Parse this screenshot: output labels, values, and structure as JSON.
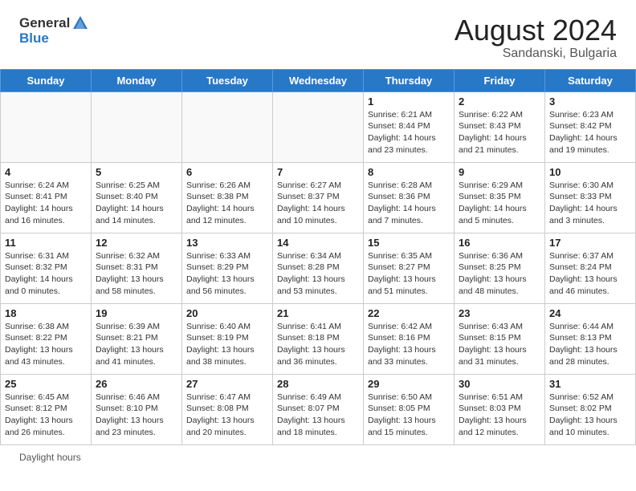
{
  "header": {
    "logo_general": "General",
    "logo_blue": "Blue",
    "month_year": "August 2024",
    "location": "Sandanski, Bulgaria"
  },
  "days_of_week": [
    "Sunday",
    "Monday",
    "Tuesday",
    "Wednesday",
    "Thursday",
    "Friday",
    "Saturday"
  ],
  "legend": {
    "daylight_label": "Daylight hours"
  },
  "weeks": [
    [
      {
        "day": "",
        "info": ""
      },
      {
        "day": "",
        "info": ""
      },
      {
        "day": "",
        "info": ""
      },
      {
        "day": "",
        "info": ""
      },
      {
        "day": "1",
        "info": "Sunrise: 6:21 AM\nSunset: 8:44 PM\nDaylight: 14 hours\nand 23 minutes."
      },
      {
        "day": "2",
        "info": "Sunrise: 6:22 AM\nSunset: 8:43 PM\nDaylight: 14 hours\nand 21 minutes."
      },
      {
        "day": "3",
        "info": "Sunrise: 6:23 AM\nSunset: 8:42 PM\nDaylight: 14 hours\nand 19 minutes."
      }
    ],
    [
      {
        "day": "4",
        "info": "Sunrise: 6:24 AM\nSunset: 8:41 PM\nDaylight: 14 hours\nand 16 minutes."
      },
      {
        "day": "5",
        "info": "Sunrise: 6:25 AM\nSunset: 8:40 PM\nDaylight: 14 hours\nand 14 minutes."
      },
      {
        "day": "6",
        "info": "Sunrise: 6:26 AM\nSunset: 8:38 PM\nDaylight: 14 hours\nand 12 minutes."
      },
      {
        "day": "7",
        "info": "Sunrise: 6:27 AM\nSunset: 8:37 PM\nDaylight: 14 hours\nand 10 minutes."
      },
      {
        "day": "8",
        "info": "Sunrise: 6:28 AM\nSunset: 8:36 PM\nDaylight: 14 hours\nand 7 minutes."
      },
      {
        "day": "9",
        "info": "Sunrise: 6:29 AM\nSunset: 8:35 PM\nDaylight: 14 hours\nand 5 minutes."
      },
      {
        "day": "10",
        "info": "Sunrise: 6:30 AM\nSunset: 8:33 PM\nDaylight: 14 hours\nand 3 minutes."
      }
    ],
    [
      {
        "day": "11",
        "info": "Sunrise: 6:31 AM\nSunset: 8:32 PM\nDaylight: 14 hours\nand 0 minutes."
      },
      {
        "day": "12",
        "info": "Sunrise: 6:32 AM\nSunset: 8:31 PM\nDaylight: 13 hours\nand 58 minutes."
      },
      {
        "day": "13",
        "info": "Sunrise: 6:33 AM\nSunset: 8:29 PM\nDaylight: 13 hours\nand 56 minutes."
      },
      {
        "day": "14",
        "info": "Sunrise: 6:34 AM\nSunset: 8:28 PM\nDaylight: 13 hours\nand 53 minutes."
      },
      {
        "day": "15",
        "info": "Sunrise: 6:35 AM\nSunset: 8:27 PM\nDaylight: 13 hours\nand 51 minutes."
      },
      {
        "day": "16",
        "info": "Sunrise: 6:36 AM\nSunset: 8:25 PM\nDaylight: 13 hours\nand 48 minutes."
      },
      {
        "day": "17",
        "info": "Sunrise: 6:37 AM\nSunset: 8:24 PM\nDaylight: 13 hours\nand 46 minutes."
      }
    ],
    [
      {
        "day": "18",
        "info": "Sunrise: 6:38 AM\nSunset: 8:22 PM\nDaylight: 13 hours\nand 43 minutes."
      },
      {
        "day": "19",
        "info": "Sunrise: 6:39 AM\nSunset: 8:21 PM\nDaylight: 13 hours\nand 41 minutes."
      },
      {
        "day": "20",
        "info": "Sunrise: 6:40 AM\nSunset: 8:19 PM\nDaylight: 13 hours\nand 38 minutes."
      },
      {
        "day": "21",
        "info": "Sunrise: 6:41 AM\nSunset: 8:18 PM\nDaylight: 13 hours\nand 36 minutes."
      },
      {
        "day": "22",
        "info": "Sunrise: 6:42 AM\nSunset: 8:16 PM\nDaylight: 13 hours\nand 33 minutes."
      },
      {
        "day": "23",
        "info": "Sunrise: 6:43 AM\nSunset: 8:15 PM\nDaylight: 13 hours\nand 31 minutes."
      },
      {
        "day": "24",
        "info": "Sunrise: 6:44 AM\nSunset: 8:13 PM\nDaylight: 13 hours\nand 28 minutes."
      }
    ],
    [
      {
        "day": "25",
        "info": "Sunrise: 6:45 AM\nSunset: 8:12 PM\nDaylight: 13 hours\nand 26 minutes."
      },
      {
        "day": "26",
        "info": "Sunrise: 6:46 AM\nSunset: 8:10 PM\nDaylight: 13 hours\nand 23 minutes."
      },
      {
        "day": "27",
        "info": "Sunrise: 6:47 AM\nSunset: 8:08 PM\nDaylight: 13 hours\nand 20 minutes."
      },
      {
        "day": "28",
        "info": "Sunrise: 6:49 AM\nSunset: 8:07 PM\nDaylight: 13 hours\nand 18 minutes."
      },
      {
        "day": "29",
        "info": "Sunrise: 6:50 AM\nSunset: 8:05 PM\nDaylight: 13 hours\nand 15 minutes."
      },
      {
        "day": "30",
        "info": "Sunrise: 6:51 AM\nSunset: 8:03 PM\nDaylight: 13 hours\nand 12 minutes."
      },
      {
        "day": "31",
        "info": "Sunrise: 6:52 AM\nSunset: 8:02 PM\nDaylight: 13 hours\nand 10 minutes."
      }
    ]
  ]
}
